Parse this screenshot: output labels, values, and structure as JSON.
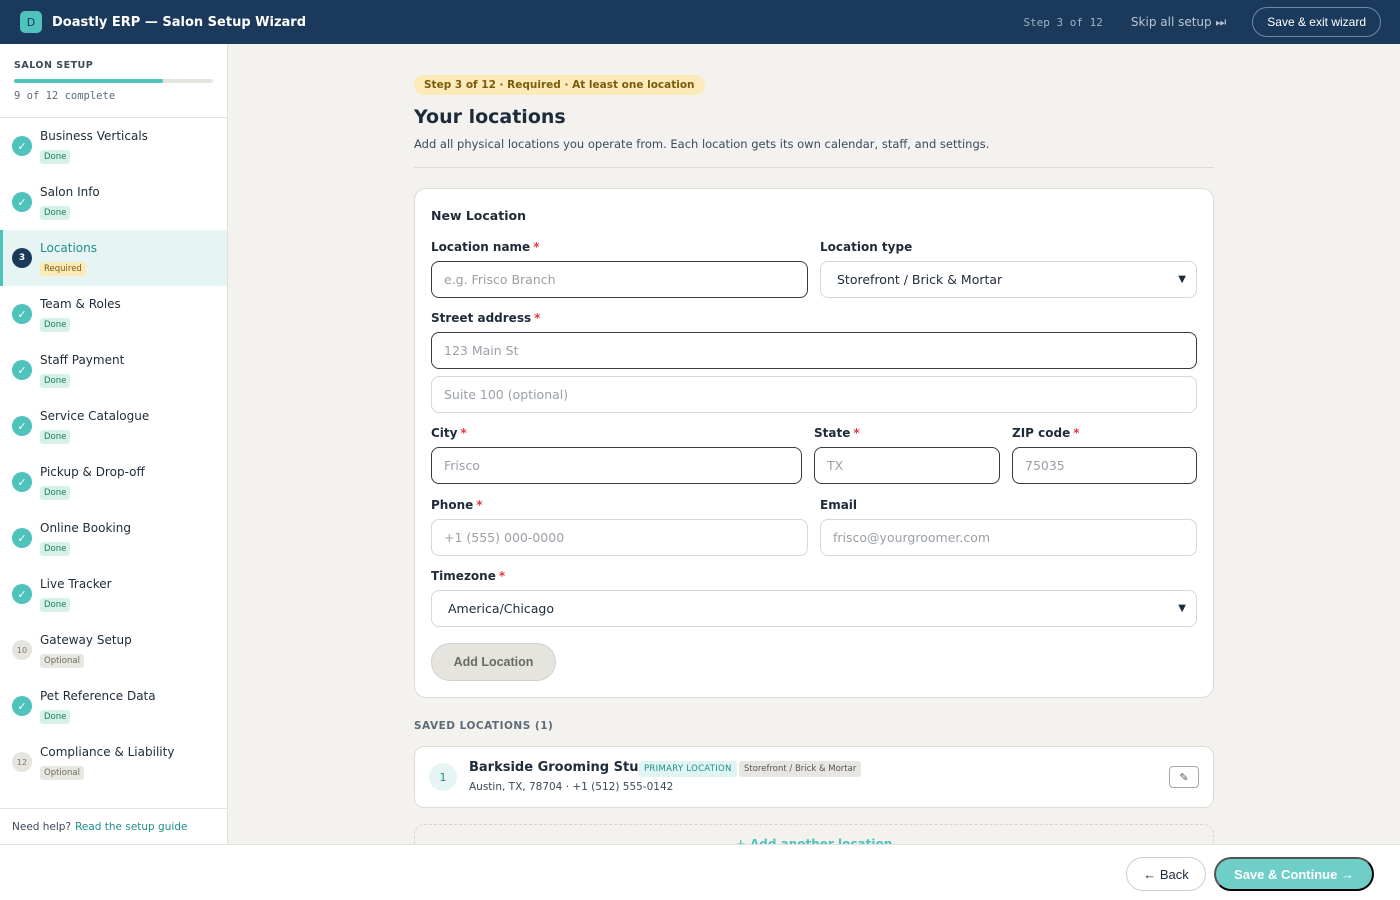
{
  "header": {
    "logo_letter": "D",
    "title": "Doastly ERP — Salon Setup Wizard",
    "step_counter": "Step 3 of 12",
    "skip_label": "Skip all setup ⏭",
    "exit_label": "Save & exit wizard"
  },
  "sidebar": {
    "heading": "SALON SETUP",
    "progress_fraction": 0.75,
    "progress_text": "9 of 12 complete",
    "items": [
      {
        "marker": "✓",
        "name": "Business Verticals",
        "badge": "Done"
      },
      {
        "marker": "✓",
        "name": "Salon Info",
        "badge": "Done"
      },
      {
        "marker": "3",
        "name": "Locations",
        "badge": "Required"
      },
      {
        "marker": "✓",
        "name": "Team & Roles",
        "badge": "Done"
      },
      {
        "marker": "✓",
        "name": "Staff Payment",
        "badge": "Done"
      },
      {
        "marker": "✓",
        "name": "Service Catalogue",
        "badge": "Done"
      },
      {
        "marker": "✓",
        "name": "Pickup & Drop-off",
        "badge": "Done"
      },
      {
        "marker": "✓",
        "name": "Online Booking",
        "badge": "Done"
      },
      {
        "marker": "✓",
        "name": "Live Tracker",
        "badge": "Done"
      },
      {
        "marker": "10",
        "name": "Gateway Setup",
        "badge": "Optional"
      },
      {
        "marker": "✓",
        "name": "Pet Reference Data",
        "badge": "Done"
      },
      {
        "marker": "12",
        "name": "Compliance & Liability",
        "badge": "Optional"
      }
    ],
    "help_text": "Need help?",
    "help_link": "Read the setup guide"
  },
  "main": {
    "step_pill": "Step 3 of 12 · Required · At least one location",
    "title": "Your locations",
    "subtitle": "Add all physical locations you operate from. Each location gets its own calendar, staff, and settings.",
    "form": {
      "card_title": "New Location",
      "location_name_label": "Location name",
      "location_name_placeholder": "e.g. Frisco Branch",
      "location_type_label": "Location type",
      "location_type_value": "Storefront / Brick & Mortar",
      "street_label": "Street address",
      "street_placeholder": "123 Main St",
      "suite_placeholder": "Suite 100 (optional)",
      "city_label": "City",
      "city_placeholder": "Frisco",
      "state_label": "State",
      "state_placeholder": "TX",
      "zip_label": "ZIP code",
      "zip_placeholder": "75035",
      "phone_label": "Phone",
      "phone_placeholder": "+1 (555) 000-0000",
      "email_label": "Email",
      "email_placeholder": "frisco@yourgroomer.com",
      "timezone_label": "Timezone",
      "timezone_value": "America/Chicago",
      "required_mark": "*",
      "add_button": "Add Location"
    },
    "saved": {
      "label": "SAVED LOCATIONS (1)",
      "items": [
        {
          "index": "1",
          "name": "Barkside Grooming Studio",
          "primary_badge": "PRIMARY LOCATION",
          "type_badge": "Storefront / Brick & Mortar",
          "address": "Austin, TX, 78704 · +1 (512) 555-0142"
        }
      ],
      "add_another": "+ Add another location"
    }
  },
  "footer": {
    "back_label": "← Back",
    "continue_label": "Save & Continue →"
  },
  "colors": {
    "topbar": "#1b3a5b",
    "accent": "#4fc2bc",
    "required": "#e0393e"
  }
}
